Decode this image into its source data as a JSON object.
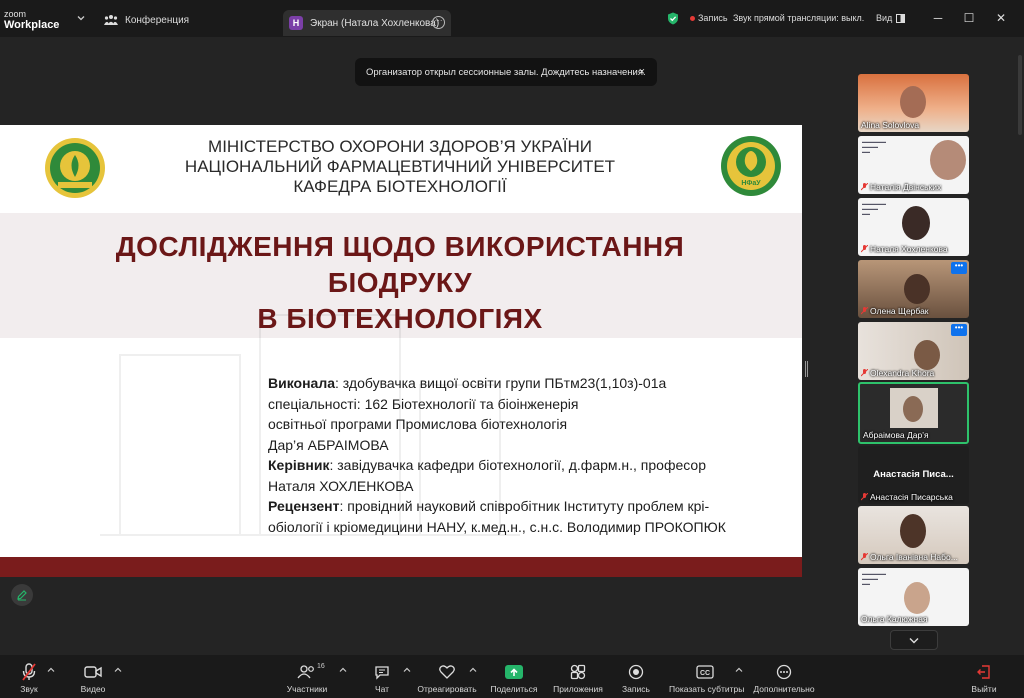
{
  "titlebar": {
    "logo_line1": "zoom",
    "logo_line2": "Workplace",
    "tab_conference": "Конференция",
    "tab_screen_badge": "Н",
    "tab_screen": "Экран (Натала Хохленкова)",
    "record_label": "Запись",
    "stream_label": "Звук прямой трансляции: выкл.",
    "view_label": "Вид"
  },
  "toast": {
    "text": "Организатор открыл сессионные залы. Дождитесь назначения.",
    "close": "×"
  },
  "slide": {
    "header_lines": [
      "МІНІСТЕРСТВО ОХОРОНИ ЗДОРОВ’Я УКРАЇНИ",
      "НАЦІОНАЛЬНИЙ ФАРМАЦЕВТИЧНИЙ УНІВЕРСИТЕТ",
      "КАФЕДРА БІОТЕХНОЛОГІЇ"
    ],
    "title_lines": [
      "ДОСЛІДЖЕННЯ ЩОДО ВИКОРИСТАННЯ",
      "БІОДРУКУ",
      "В БІОТЕХНОЛОГІЯХ"
    ],
    "left_emblem_text": [
      "1805",
      "ЗДОРОВ’Я",
      "ЗАПОРУКА"
    ],
    "right_emblem_text": "НФаУ",
    "performer_label": "Виконала",
    "performer_text": ": здобувачка вищої освіти групи ПБтм23(1,10з)-01а",
    "performer_line2": "спеціальності: 162 Біотехнології та біоінженерія",
    "performer_line3": "освітньої програми Промислова біотехнологія",
    "performer_line4": "Дар’я АБРАІМОВА",
    "supervisor_label": "Керівник",
    "supervisor_text": ": завідувачка кафедри біотехнології, д.фарм.н., професор",
    "supervisor_line2": "Наталя ХОХЛЕНКОВА",
    "reviewer_label": "Рецензент",
    "reviewer_text": ": провідний науковий співробітник Інституту проблем крі-",
    "reviewer_line2": "обіології і кріомедицини НАНУ, к.мед.н., с.н.с. Володимир ПРОКОПЮК"
  },
  "participants": [
    {
      "name": "Alina Solovlova",
      "muted": false,
      "type": "video"
    },
    {
      "name": "Наталія Двінських",
      "muted": true,
      "type": "video-doc"
    },
    {
      "name": "Наталя Хохленкова",
      "muted": true,
      "type": "video-doc"
    },
    {
      "name": "Олена Щербак",
      "muted": true,
      "type": "video",
      "options": "•••"
    },
    {
      "name": "Olexandra Khora",
      "muted": true,
      "type": "video",
      "options": "•••"
    },
    {
      "name": "Абраімова Дар’я",
      "muted": false,
      "type": "video",
      "active": true
    },
    {
      "name": "Анастасія Писарська",
      "muted": true,
      "type": "name",
      "big_name": "Анастасія Писа..."
    },
    {
      "name": "Ольга Іванівна Набо...",
      "muted": true,
      "type": "video"
    },
    {
      "name": "Ольга Калюжная",
      "muted": false,
      "type": "video-doc"
    }
  ],
  "toolbar": {
    "audio": "Звук",
    "video": "Видео",
    "participants": "Участники",
    "participants_count": "16",
    "chat": "Чат",
    "react": "Отреагировать",
    "share": "Поделиться",
    "apps": "Приложения",
    "record": "Запись",
    "captions": "Показать субтитры",
    "captions_badge": "CC",
    "more": "Дополнительно",
    "leave": "Выйти"
  },
  "colors": {
    "accent_green": "#25b56a",
    "title_red": "#6b1717",
    "active_border": "#2ec26b",
    "record_red": "#e53935"
  }
}
